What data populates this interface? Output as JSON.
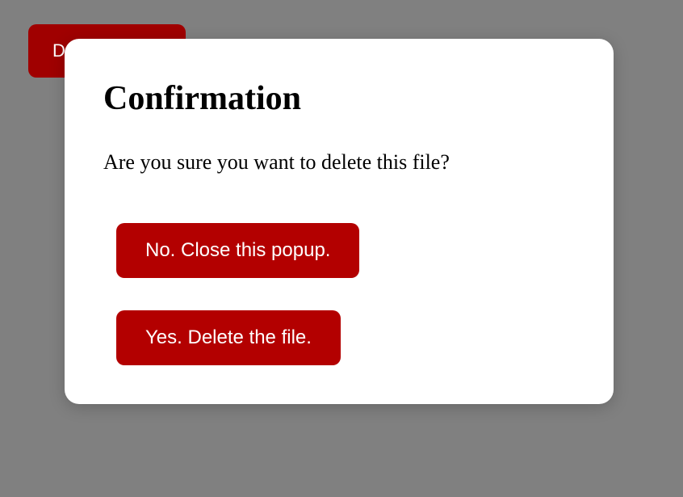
{
  "trigger": {
    "label": "Delete the file"
  },
  "modal": {
    "title": "Confirmation",
    "message": "Are you sure you want to delete this file?",
    "cancel_label": "No. Close this popup.",
    "confirm_label": "Yes. Delete the file."
  },
  "colors": {
    "button_bg": "#b30000",
    "overlay": "#808080"
  }
}
